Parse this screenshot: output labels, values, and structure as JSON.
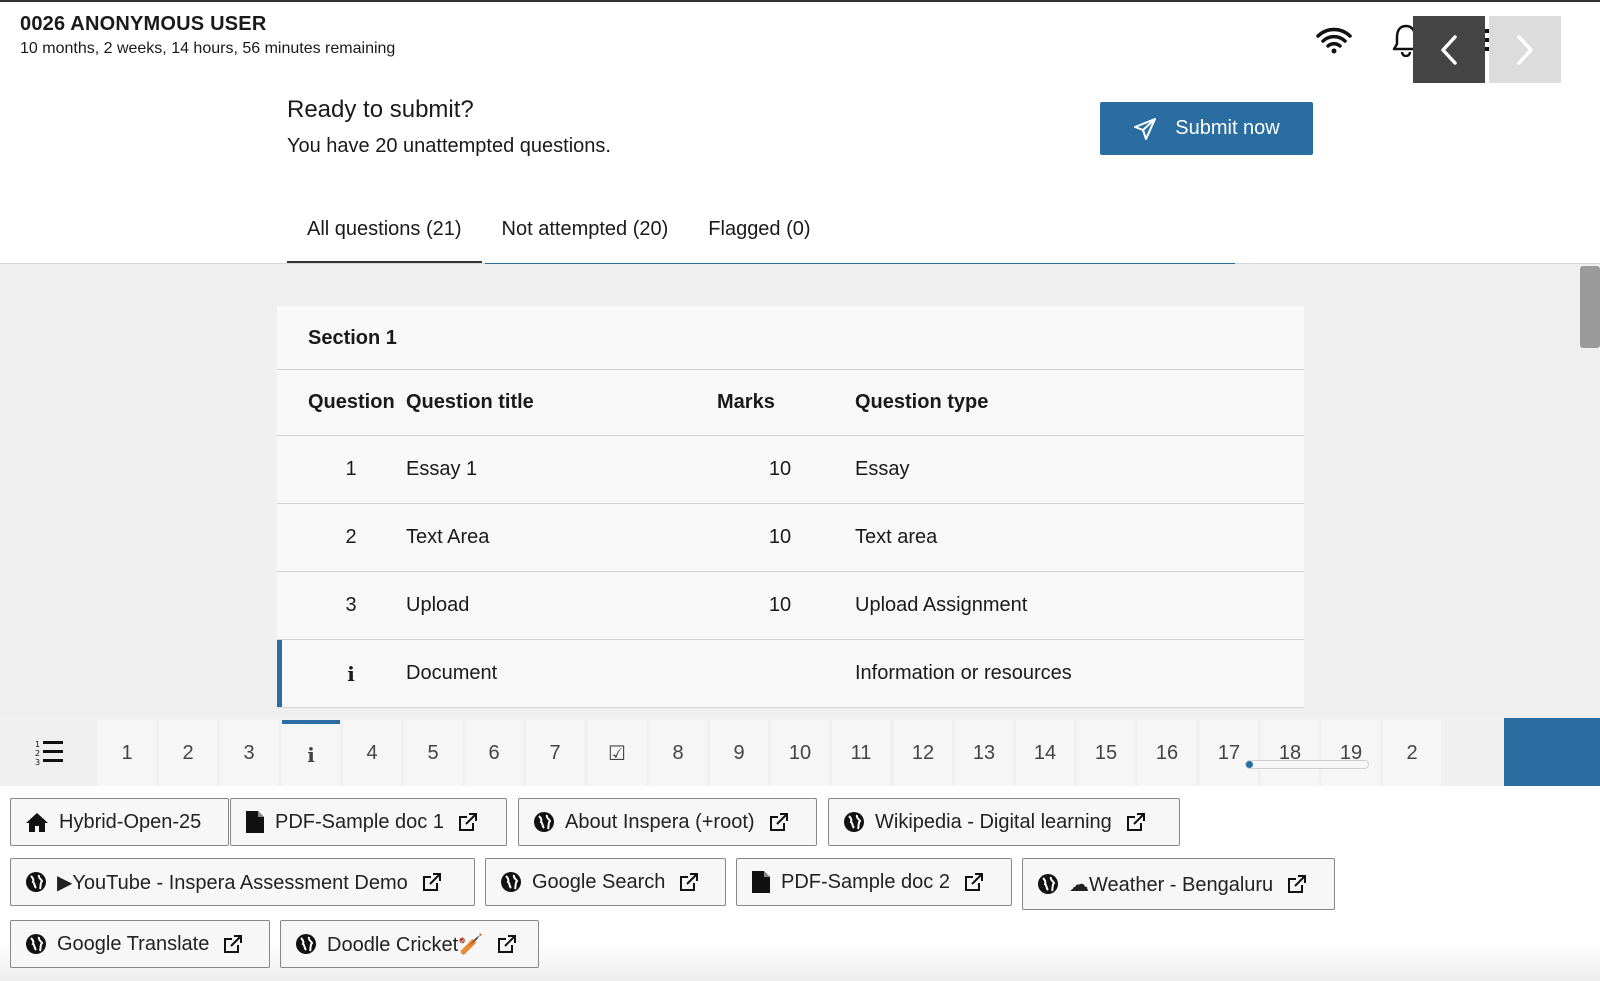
{
  "header": {
    "user_name": "0026 ANONYMOUS USER",
    "time_remaining": "10 months, 2 weeks, 14 hours, 56 minutes remaining",
    "icons": [
      "wifi-icon",
      "bell-icon",
      "menu-icon",
      "chat-icon"
    ]
  },
  "submit": {
    "title": "Ready to submit?",
    "message": "You have 20 unattempted questions.",
    "button_label": "Submit now"
  },
  "tabs": [
    {
      "label": "All questions (21)",
      "active": true
    },
    {
      "label": "Not attempted (20)",
      "active": false
    },
    {
      "label": "Flagged (0)",
      "active": false
    }
  ],
  "section": {
    "title": "Section 1",
    "columns": [
      "Question",
      "Question title",
      "Marks",
      "Question type"
    ],
    "rows": [
      {
        "question": "1",
        "title": "Essay 1",
        "marks": "10",
        "type": "Essay"
      },
      {
        "question": "2",
        "title": "Text Area",
        "marks": "10",
        "type": "Text area"
      },
      {
        "question": "3",
        "title": "Upload",
        "marks": "10",
        "type": "Upload Assignment"
      },
      {
        "question": "i",
        "title": "Document",
        "marks": "",
        "type": "Information or resources"
      }
    ]
  },
  "question_nav": {
    "items": [
      "1",
      "2",
      "3",
      "i",
      "4",
      "5",
      "6",
      "7",
      "☑",
      "8",
      "9",
      "10",
      "11",
      "12",
      "13",
      "14",
      "15",
      "16",
      "17",
      "18",
      "19",
      "2"
    ],
    "current_index": 3,
    "scroll_position_fraction": 0
  },
  "resource_links": [
    {
      "label": "Hybrid-Open-25",
      "icon": "home-icon",
      "external": false
    },
    {
      "label": "PDF-Sample doc 1",
      "icon": "file-icon",
      "external": true
    },
    {
      "label": "About Inspera (+root)",
      "icon": "globe-icon",
      "external": true
    },
    {
      "label": "Wikipedia - Digital learning",
      "icon": "globe-icon",
      "external": true
    },
    {
      "label": "▶YouTube - Inspera Assessment Demo",
      "icon": "globe-icon",
      "external": true
    },
    {
      "label": "Google Search",
      "icon": "globe-icon",
      "external": true
    },
    {
      "label": "PDF-Sample doc 2",
      "icon": "file-icon",
      "external": true
    },
    {
      "label": "☁Weather - Bengaluru",
      "icon": "globe-icon",
      "external": true
    },
    {
      "label": "Google Translate",
      "icon": "globe-icon",
      "external": true
    },
    {
      "label": "Doodle Cricket🏏",
      "icon": "globe-icon",
      "external": true
    }
  ],
  "colors": {
    "accent": "#2a6da1",
    "nav_dark": "#444444"
  }
}
